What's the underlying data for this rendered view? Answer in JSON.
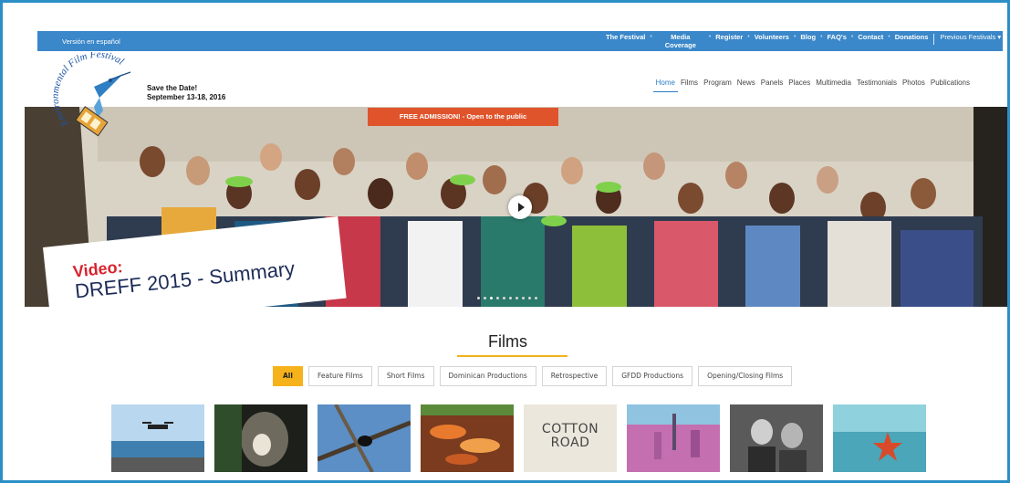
{
  "topbar": {
    "spanish_link": "Versión en español",
    "links": [
      "The Festival",
      "Media Coverage",
      "Register",
      "Volunteers",
      "Blog",
      "FAQ's",
      "Contact",
      "Donations"
    ],
    "previous_festivals": "Previous Festivals"
  },
  "header": {
    "logo_text": "Environmental Film Festival",
    "save_date_line1": "Save the Date!",
    "save_date_line2": "September 13-18, 2016"
  },
  "mainnav": {
    "items": [
      "Home",
      "Films",
      "Program",
      "News",
      "Panels",
      "Places",
      "Multimedia",
      "Testimonials",
      "Photos",
      "Publications"
    ],
    "active": "Home"
  },
  "hero": {
    "banner": "FREE ADMISSION! - Open to the public",
    "caption_kicker": "Video:",
    "caption_title": "DREFF 2015 - Summary",
    "slide_count": 10,
    "active_slide": 2
  },
  "films": {
    "title": "Films",
    "filters": [
      "All",
      "Feature Films",
      "Short Films",
      "Dominican Productions",
      "Retrospective",
      "GFDD Productions",
      "Opening/Closing Films"
    ],
    "active_filter": "All",
    "thumbnails": [
      {
        "name": "drone-over-sea",
        "text": ""
      },
      {
        "name": "lion-roaring",
        "text": ""
      },
      {
        "name": "bird-on-branch",
        "text": ""
      },
      {
        "name": "fish-market",
        "text": ""
      },
      {
        "name": "cotton-road-poster",
        "text": "COTTON ROAD"
      },
      {
        "name": "city-aerial",
        "text": ""
      },
      {
        "name": "children-portrait",
        "text": ""
      },
      {
        "name": "starfish-underwater",
        "text": ""
      }
    ]
  },
  "colors": {
    "frame": "#2b8fc6",
    "topbar": "#3a87c9",
    "banner": "#e0542c",
    "accent": "#f6b21b",
    "active_nav": "#2b7dc7"
  }
}
